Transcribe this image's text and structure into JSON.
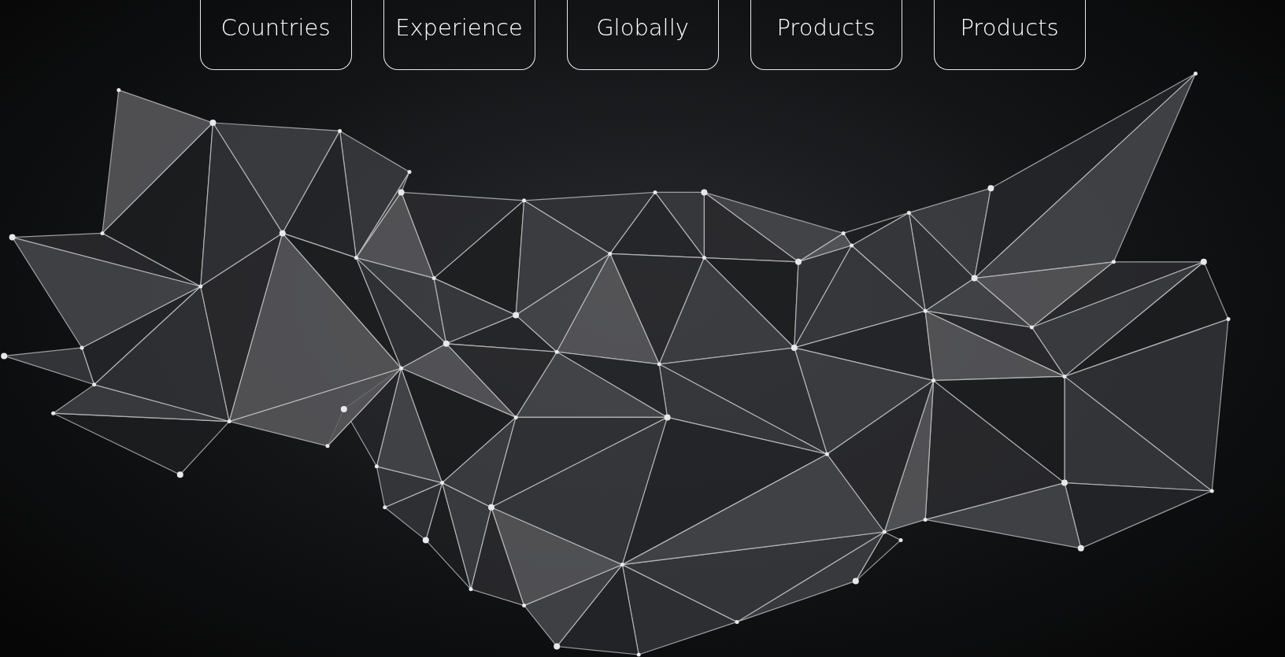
{
  "stats": [
    {
      "label": "Countries"
    },
    {
      "label": "Experience"
    },
    {
      "label": "Globally"
    },
    {
      "label": "Products"
    },
    {
      "label": "Products"
    }
  ]
}
